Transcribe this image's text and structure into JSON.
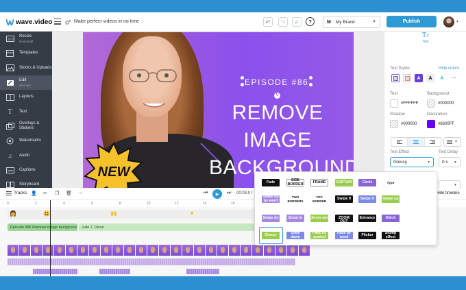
{
  "brand_colors": {
    "accent": "#2f9bd5",
    "sidebar": "#353c46",
    "video_purple": "#9a57e3",
    "effect_green": "#9acd4c"
  },
  "topbar": {
    "logo_text": "wave.video",
    "tagline": "Make perfect videos in no time",
    "brand_initial": "M",
    "brand_name": "My Brand",
    "publish_label": "Publish",
    "help_label": "?"
  },
  "sidebar": {
    "items": [
      {
        "label": "Resize",
        "sub": "Horizontal",
        "icon": "resize-icon"
      },
      {
        "label": "Templates",
        "sub": "",
        "icon": "templates-icon"
      },
      {
        "label": "Stocks & Uploads",
        "sub": "",
        "icon": "image-icon"
      },
      {
        "label": "Edit",
        "sub": "20.6 sec",
        "icon": "edit-icon"
      },
      {
        "label": "Layouts",
        "sub": "",
        "icon": "layouts-icon"
      },
      {
        "label": "Text",
        "sub": "",
        "icon": "text-icon"
      },
      {
        "label": "Overlays & Stickers",
        "sub": "",
        "icon": "overlays-icon"
      },
      {
        "label": "Watermarks",
        "sub": "",
        "icon": "watermark-icon"
      },
      {
        "label": "Audio",
        "sub": "",
        "icon": "audio-icon"
      },
      {
        "label": "Captions",
        "sub": "",
        "icon": "captions-icon"
      },
      {
        "label": "Storyboard",
        "sub": "",
        "icon": "storyboard-icon"
      }
    ]
  },
  "video": {
    "episode_text": "EPISODE #86",
    "title_line1": "REMOVE IMAGE",
    "title_line2": "BACKGROUND",
    "badge_text": "NEW"
  },
  "right_panel": {
    "tab_label": "Text",
    "text_styles_label": "Text Styles",
    "hide_colors": "Hide colors",
    "text_label": "Text",
    "text_color": "#FFFFFF",
    "background_label": "Background",
    "background_color": "#000000",
    "shadow_label": "Shadow",
    "shadow_color": "#000000",
    "decoration_label": "Decoration",
    "decoration_color": "#6600FF",
    "text_effect_label": "Text Effect",
    "text_effect_value": "Glossy",
    "text_delay_label": "Text Delay",
    "text_delay_value": "0 s"
  },
  "timeline": {
    "tracks_label": "Tracks",
    "timecode": "00:03.0 /",
    "hide_timeline": "Hide timeline",
    "ruler": [
      "0",
      "2",
      "4",
      "6",
      "8",
      "10",
      "12",
      "14",
      "16",
      "18",
      "20"
    ],
    "clip1": "Episode #86 Remove image background",
    "clip2": "Julie J. Dixon"
  },
  "effects": [
    {
      "label": "Fade",
      "style": "black"
    },
    {
      "label": "SIDE BORDER",
      "style": "white"
    },
    {
      "label": "FRAME",
      "style": "white"
    },
    {
      "label": "CURTAIN",
      "style": "green"
    },
    {
      "label": "Circle",
      "style": "purple"
    },
    {
      "label": "Typo",
      "style": "plain"
    },
    {
      "label": "Swipe up by word",
      "style": "lpurple"
    },
    {
      "label": "TWO BORDERS",
      "style": "plain"
    },
    {
      "label": "TOP BORDER",
      "style": "plain"
    },
    {
      "label": "Swipe lf",
      "style": "black"
    },
    {
      "label": "Swipe rt",
      "style": "blue"
    },
    {
      "label": "Swipe up",
      "style": "green"
    },
    {
      "label": "Swipe dn",
      "style": "lpurple"
    },
    {
      "label": "Zoom in",
      "style": "lpurple"
    },
    {
      "label": "Zoom out",
      "style": "green"
    },
    {
      "label": "SUPER ZOOM OUT",
      "style": "black"
    },
    {
      "label": "Entrance",
      "style": "black"
    },
    {
      "label": "Glitch",
      "style": "purple"
    },
    {
      "label": "Glossy",
      "style": "green"
    },
    {
      "label": "Slide down",
      "style": "blue"
    },
    {
      "label": "Fade by symbol",
      "style": "green"
    },
    {
      "label": "Fade by word",
      "style": "blue"
    },
    {
      "label": "Flicker",
      "style": "black"
    },
    {
      "label": "Stomp effect",
      "style": "black"
    }
  ]
}
